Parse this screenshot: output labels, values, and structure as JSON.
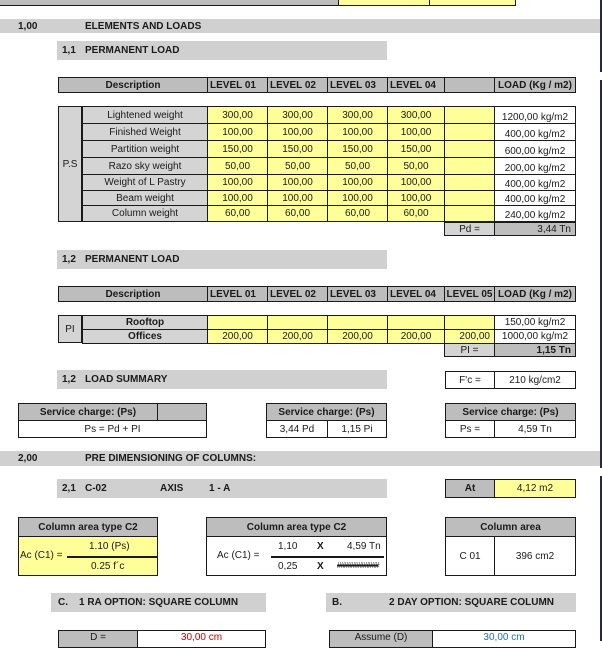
{
  "sections": {
    "s1": {
      "num": "1,00",
      "title": "ELEMENTS AND LOADS"
    },
    "s11": {
      "num": "1,1",
      "title": "PERMANENT LOAD"
    },
    "s12a": {
      "num": "1,2",
      "title": "PERMANENT LOAD"
    },
    "s12b": {
      "num": "1,2",
      "title": "LOAD SUMMARY"
    },
    "s2": {
      "num": "2,00",
      "title": "PRE DIMENSIONING OF COLUMNS:"
    },
    "s21": {
      "num": "2,1",
      "title": "C-02",
      "axis_label": "AXIS",
      "axis_value": "1 - A"
    },
    "optC": {
      "num": "C.",
      "title": "1 RA OPTION: SQUARE COLUMN"
    },
    "optB": {
      "num": "B.",
      "title": "2 DAY OPTION: SQUARE COLUMN"
    }
  },
  "table1": {
    "headers": [
      "Description",
      "LEVEL 01",
      "LEVEL 02",
      "LEVEL 03",
      "LEVEL 04",
      "",
      "LOAD (Kg / m2)"
    ],
    "group": "P.S",
    "rows": [
      {
        "desc": "Lightened weight",
        "l1": "300,00",
        "l2": "300,00",
        "l3": "300,00",
        "l4": "300,00",
        "load": "1200,00 kg/m2"
      },
      {
        "desc": "Finished Weight",
        "l1": "100,00",
        "l2": "100,00",
        "l3": "100,00",
        "l4": "100,00",
        "load": "400,00 kg/m2"
      },
      {
        "desc": "Partition weight",
        "l1": "150,00",
        "l2": "150,00",
        "l3": "150,00",
        "l4": "150,00",
        "load": "600,00 kg/m2"
      },
      {
        "desc": "Razo sky weight",
        "l1": "50,00",
        "l2": "50,00",
        "l3": "50,00",
        "l4": "50,00",
        "load": "200,00 kg/m2"
      },
      {
        "desc": "Weight of L Pastry",
        "l1": "100,00",
        "l2": "100,00",
        "l3": "100,00",
        "l4": "100,00",
        "load": "400,00 kg/m2"
      },
      {
        "desc": "Beam weight",
        "l1": "100,00",
        "l2": "100,00",
        "l3": "100,00",
        "l4": "100,00",
        "load": "400,00 kg/m2"
      },
      {
        "desc": "Column weight",
        "l1": "60,00",
        "l2": "60,00",
        "l3": "60,00",
        "l4": "60,00",
        "load": "240,00 kg/m2"
      }
    ],
    "total_label": "Pd =",
    "total_value": "3,44 Tn"
  },
  "table2": {
    "headers": [
      "Description",
      "LEVEL 01",
      "LEVEL 02",
      "LEVEL 03",
      "LEVEL 04",
      "LEVEL 05",
      "LOAD (Kg / m2)"
    ],
    "group": "PI",
    "rows": [
      {
        "desc": "Rooftop",
        "l1": "",
        "l2": "",
        "l3": "",
        "l4": "",
        "l5": "",
        "load": "150,00 kg/m2"
      },
      {
        "desc": "Offices",
        "l1": "200,00",
        "l2": "200,00",
        "l3": "200,00",
        "l4": "200,00",
        "l5": "200,00",
        "load": "1000,00 kg/m2"
      }
    ],
    "total_label": "PI =",
    "total_value": "1,15 Tn"
  },
  "fc": {
    "label": "F'c =",
    "value": "210 kg/cm2"
  },
  "service1": {
    "title": "Service charge: (Ps)",
    "formula": "Ps = Pd + PI"
  },
  "service2": {
    "title": "Service charge: (Ps)",
    "pd": "3,44 Pd",
    "pi": "1,15 Pi"
  },
  "service3": {
    "title": "Service charge: (Ps)",
    "label": "Ps =",
    "value": "4,59 Tn"
  },
  "at": {
    "label": "At",
    "value": "4,12 m2"
  },
  "colArea1": {
    "title": "Column area type C2",
    "lhs": "Ac (C1) =",
    "num": "1.10 (Ps)",
    "den": "0.25 f´c"
  },
  "colArea2": {
    "title": "Column area type C2",
    "lhs": "Ac (C1) =",
    "num_a": "1,10",
    "num_x": "X",
    "num_b": "4,59 Tn",
    "den_a": "0,25",
    "den_x": "X",
    "den_b": "############"
  },
  "colArea3": {
    "title": "Column area",
    "name": "C 01",
    "value": "396 cm2"
  },
  "optC_row": {
    "label": "D =",
    "value": "30,00 cm"
  },
  "optB_row": {
    "label": "Assume (D)",
    "value": "30,00 cm"
  }
}
